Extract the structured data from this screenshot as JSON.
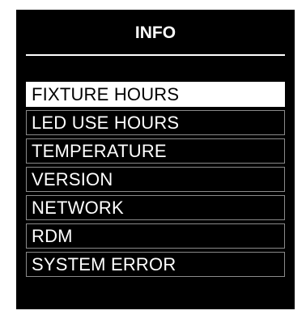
{
  "screen": {
    "title": "INFO"
  },
  "menu": {
    "items": [
      {
        "label": "FIXTURE HOURS",
        "selected": true
      },
      {
        "label": "LED USE HOURS",
        "selected": false
      },
      {
        "label": "TEMPERATURE",
        "selected": false
      },
      {
        "label": "VERSION",
        "selected": false
      },
      {
        "label": "NETWORK",
        "selected": false
      },
      {
        "label": "RDM",
        "selected": false
      },
      {
        "label": "SYSTEM ERROR",
        "selected": false
      }
    ]
  },
  "colors": {
    "background": "#000000",
    "text": "#ffffff",
    "selected_background": "#ffffff",
    "selected_text": "#000000",
    "item_border": "#8a8a8a"
  }
}
